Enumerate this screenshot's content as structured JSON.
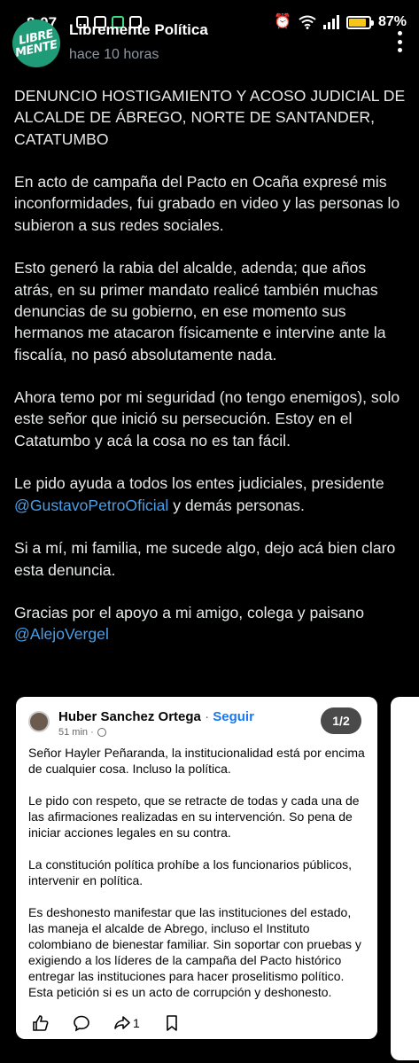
{
  "status_bar": {
    "time": "8:07",
    "battery_percent": "87%",
    "battery_level": 0.87
  },
  "header": {
    "author": "Libremente Política",
    "timestamp": "hace 10 horas",
    "avatar_text_line1": "LIBRE",
    "avatar_text_line2": "MENTE"
  },
  "post": {
    "paragraphs": [
      "DENUNCIO HOSTIGAMIENTO Y ACOSO JUDICIAL DE ALCALDE DE ÁBREGO, NORTE DE SANTANDER, CATATUMBO",
      "En acto de campaña del Pacto en Ocaña expresé mis inconformidades, fui grabado en video y las personas lo subieron a sus redes sociales.",
      "Esto generó la rabia del alcalde, adenda; que años atrás, en su primer mandato realicé también muchas denuncias de su gobierno, en ese momento sus hermanos me atacaron físicamente e intervine ante la fiscalía, no pasó absolutamente nada.",
      "Ahora temo por mi seguridad (no tengo enemigos), solo este señor que inició su persecución. Estoy en el Catatumbo y acá la cosa no es tan fácil."
    ],
    "p5_before": "Le pido ayuda a todos los entes judiciales, presidente ",
    "p5_mention": "@GustavoPetroOficial",
    "p5_after": " y demás personas.",
    "p6": "Si a mí, mi familia, me sucede algo, dejo acá bien claro esta denuncia.",
    "p7": "Gracias por el apoyo a mi amigo, colega y paisano",
    "p7_mention": "@AlejoVergel"
  },
  "embedded_card": {
    "name": "Huber Sanchez Ortega",
    "separator": "·",
    "follow_label": "Seguir",
    "time": "51 min ·",
    "pager": "1/2",
    "paragraphs": [
      "Señor Hayler Peñaranda, la institucionalidad está por encima de cualquier cosa. Incluso la política.",
      "Le pido con respeto, que se retracte de todas y cada una de las afirmaciones realizadas en su intervención. So pena de iniciar acciones legales en su contra.",
      "La constitución política prohíbe a los funcionarios públicos, intervenir en política.",
      "Es deshonesto manifestar que las instituciones del estado, las maneja el alcalde de Abrego, incluso el Instituto colombiano de bienestar familiar. Sin soportar con pruebas y exigiendo a los líderes de la campaña del Pacto histórico entregar las instituciones para hacer proselitismo político. Esta petición si es un acto de corrupción y deshonesto."
    ],
    "share_count": "1"
  },
  "icons": {
    "status": [
      "alarm-icon",
      "wifi-icon",
      "signal-icon",
      "battery-icon"
    ],
    "card_actions": [
      "like-icon",
      "comment-icon",
      "share-icon",
      "save-icon"
    ]
  }
}
